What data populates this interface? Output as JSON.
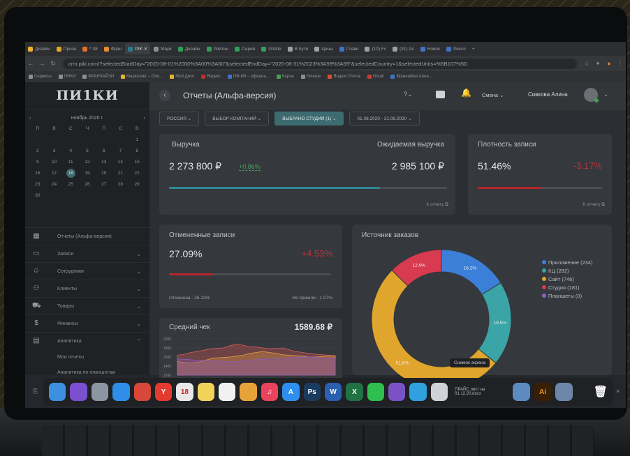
{
  "browser": {
    "tabs": [
      {
        "label": "Дизайн",
        "color": "#f2b02e",
        "active": false
      },
      {
        "label": "Презе",
        "color": "#e5a52a",
        "active": false
      },
      {
        "label": "* 38",
        "color": "#e56f2a",
        "active": false
      },
      {
        "label": "Фран",
        "color": "#e88d2b",
        "active": false
      },
      {
        "label": "PIK ✕",
        "color": "#2a7c89",
        "active": true
      },
      {
        "label": "Марк",
        "color": "#8b8f94",
        "active": false
      },
      {
        "label": "Дизайн",
        "color": "#2f9e57",
        "active": false
      },
      {
        "label": "Рейтин",
        "color": "#2f9e57",
        "active": false
      },
      {
        "label": "Серия",
        "color": "#2f9e57",
        "active": false
      },
      {
        "label": "Untitle",
        "color": "#2f9e57",
        "active": false
      },
      {
        "label": "В пути",
        "color": "#9aa0a6",
        "active": false
      },
      {
        "label": "Цены",
        "color": "#9aa0a6",
        "active": false
      },
      {
        "label": "Главн",
        "color": "#3e72c5",
        "active": false
      },
      {
        "label": "(10) Fc",
        "color": "#9aa0a6",
        "active": false
      },
      {
        "label": "(31) Ac",
        "color": "#9aa0a6",
        "active": false
      },
      {
        "label": "Новос",
        "color": "#3e72c5",
        "active": false
      },
      {
        "label": "Реклс",
        "color": "#3e72c5",
        "active": false
      }
    ],
    "new_tab": "+",
    "url": "crm.piki.com/?selectedStartDay=\"2020-08-01%2000%3A00%3A00\"&selectedEndDay=\"2020-08-31%2023%3A59%3A59\"&selectedCountry=1&selectedUnits=%5B107%5D",
    "bookmarks": [
      {
        "label": "Сервисы",
        "color": "#8a8f94"
      },
      {
        "label": "ПИКИ",
        "color": "#8a8f94"
      },
      {
        "label": "ФРАНЧАЙЗИ",
        "color": "#8a8f94"
      },
      {
        "label": "Маркетинг – Goo...",
        "color": "#e0b531"
      },
      {
        "label": "Мой Диск",
        "color": "#e0b531"
      },
      {
        "label": "Яндекс",
        "color": "#b7342c"
      },
      {
        "label": "ПИ-КИ – официа...",
        "color": "#3e72c5"
      },
      {
        "label": "Карты",
        "color": "#4a9e5b"
      },
      {
        "label": "Личное",
        "color": "#8a8f94"
      },
      {
        "label": "Яндекс Почта",
        "color": "#d7502c"
      },
      {
        "label": "Gmail",
        "color": "#c63c32"
      },
      {
        "label": "Франчайзи Алин...",
        "color": "#3e72c5"
      }
    ]
  },
  "sidebar": {
    "logo": "ПИ1КИ",
    "calendar": {
      "month": "ноябрь 2020 г.",
      "prev": "‹",
      "next": "›",
      "weekdays": [
        "П",
        "В",
        "С",
        "Ч",
        "П",
        "С",
        "В"
      ],
      "days": [
        "",
        "",
        "",
        "",
        "",
        "",
        "1",
        "2",
        "3",
        "4",
        "5",
        "6",
        "7",
        "8",
        "9",
        "10",
        "11",
        "12",
        "13",
        "14",
        "15",
        "16",
        "17",
        "18",
        "19",
        "20",
        "21",
        "22",
        "23",
        "24",
        "25",
        "26",
        "27",
        "28",
        "29",
        "30",
        "",
        "",
        "",
        "",
        "",
        ""
      ],
      "selected": "18"
    },
    "menu": [
      {
        "label": "Отчеты (Альфа-версия)",
        "icon": "▦",
        "chevron": ""
      },
      {
        "label": "Записи",
        "icon": "▭",
        "chevron": "⌄"
      },
      {
        "label": "Сотрудники",
        "icon": "☺",
        "chevron": "⌄"
      },
      {
        "label": "Клиенты",
        "icon": "⚇",
        "chevron": "⌄"
      },
      {
        "label": "Товары",
        "icon": "⛟",
        "chevron": "⌄"
      },
      {
        "label": "Финансы",
        "icon": "$",
        "chevron": "⌄"
      },
      {
        "label": "Аналитика",
        "icon": "▤",
        "chevron": "⌃"
      }
    ],
    "submenu": [
      "Мои отчеты",
      "Аналитика по планшетам"
    ]
  },
  "header": {
    "back": "‹",
    "title": "Отчеты (Альфа-версия)",
    "help": "?⌄",
    "shift": "Смена ⌄",
    "user": "Сивкова Алина",
    "user_chevron": "⌄"
  },
  "filters": [
    {
      "label": "РОССИЯ ⌄",
      "active": false
    },
    {
      "label": "ВЫБОР КОМПАНИЙ ⌄",
      "active": false
    },
    {
      "label": "ВЫБРАНО СТУДИЙ (1) ⌄",
      "active": true
    },
    {
      "label": "01.08.2020 - 31.08.2020 ⌄",
      "active": false
    }
  ],
  "revenue": {
    "title": "Выручка",
    "value": "2 273 800 ₽",
    "delta": "+0.86%",
    "expected_title": "Ожидаемая выручка",
    "expected_value": "2 985 100 ₽",
    "progress": 0.76,
    "link": "К отчету ⧉",
    "color": "#2f8a96"
  },
  "density": {
    "title": "Плотность записи",
    "value": "51.46%",
    "delta": "-3.17%",
    "progress": 0.51,
    "link": "К отчету ⧉",
    "color": "#b8262b"
  },
  "cancelled": {
    "title": "Отмененные записи",
    "value": "27.09%",
    "delta": "+4.53%",
    "progress": 0.27,
    "left_note": "Отменена - 25.13%",
    "right_note": "Не пришли - 1.97%",
    "color": "#b8262b"
  },
  "avg_check": {
    "title": "Средний чек",
    "value": "1589.68 ₽"
  },
  "chart_data": [
    {
      "type": "pie",
      "title": "Источник заказов",
      "slices": [
        {
          "name": "Приложение (234)",
          "value": 234,
          "label": "16.2%",
          "color": "#3b7fd8"
        },
        {
          "name": "КЦ (282)",
          "value": 282,
          "label": "19.5%",
          "color": "#3aa4a6"
        },
        {
          "name": "Сайт (746)",
          "value": 746,
          "label": "51.6%",
          "color": "#e0a52c"
        },
        {
          "name": "Студия (181)",
          "value": 181,
          "label": "12.5%",
          "color": "#d83a4f"
        },
        {
          "name": "Планшеты (0)",
          "value": 0,
          "label": "",
          "color": "#8b62c9"
        }
      ],
      "tooltip": "Снимок экрана"
    },
    {
      "type": "area",
      "title": "Средний чек",
      "y_ticks": [
        "2000",
        "1800",
        "1600",
        "1400",
        "1200"
      ],
      "ylim": [
        1200,
        2000
      ],
      "series": [
        {
          "color": "#d95a5a",
          "values": [
            1640,
            1660,
            1700,
            1720,
            1750,
            1780,
            1790,
            1800,
            1850,
            1880,
            1860,
            1830,
            1820,
            1800,
            1780,
            1790,
            1800,
            1760,
            1720,
            1700,
            1680,
            1660,
            1650,
            1640,
            1630
          ]
        },
        {
          "color": "#e39a43",
          "values": [
            1500,
            1480,
            1470,
            1480,
            1520,
            1560,
            1580,
            1590,
            1600,
            1620,
            1640,
            1680,
            1700,
            1720,
            1700,
            1680,
            1650,
            1640,
            1630,
            1620,
            1600,
            1600,
            1610,
            1620,
            1620
          ]
        },
        {
          "color": "#8a5ac2",
          "values": [
            1560,
            1550,
            1540,
            1530,
            1520,
            1520,
            1510,
            1500,
            1490,
            1500,
            1510,
            1530,
            1540,
            1550,
            1560,
            1560,
            1570,
            1580,
            1590,
            1600,
            1600,
            1590,
            1580,
            1570,
            1560
          ]
        }
      ]
    }
  ],
  "dock": {
    "apps": [
      {
        "name": "finder-icon",
        "label": "",
        "color": "#3d8fe0"
      },
      {
        "name": "siri-icon",
        "label": "",
        "color": "#7a4fd0"
      },
      {
        "name": "launchpad-icon",
        "label": "",
        "color": "#8c96a3"
      },
      {
        "name": "safari-icon",
        "label": "",
        "color": "#2f8fe8"
      },
      {
        "name": "chrome-icon",
        "label": "",
        "color": "#d9463a"
      },
      {
        "name": "yandex-browser-icon",
        "label": "Y",
        "color": "#e33b2e"
      },
      {
        "name": "calendar-icon",
        "label": "18",
        "color": "#e8e8e8"
      },
      {
        "name": "notes-icon",
        "label": "",
        "color": "#f2d35a"
      },
      {
        "name": "reminders-icon",
        "label": "",
        "color": "#f1f1f1"
      },
      {
        "name": "photos-icon",
        "label": "",
        "color": "#e8a23a"
      },
      {
        "name": "music-icon",
        "label": "♫",
        "color": "#e9435d"
      },
      {
        "name": "app-store-icon",
        "label": "A",
        "color": "#2e8ff0"
      },
      {
        "name": "photoshop-icon",
        "label": "Ps",
        "color": "#1b3b5e"
      },
      {
        "name": "word-icon",
        "label": "W",
        "color": "#2b5fb0"
      },
      {
        "name": "excel-icon",
        "label": "X",
        "color": "#207245"
      },
      {
        "name": "whatsapp-icon",
        "label": "",
        "color": "#2fbf4f"
      },
      {
        "name": "viber-icon",
        "label": "",
        "color": "#7b52c6"
      },
      {
        "name": "telegram-icon",
        "label": "",
        "color": "#2ea1de"
      },
      {
        "name": "preview-icon",
        "label": "",
        "color": "#cfd3d7"
      }
    ],
    "file_label": "ПРАЙС лист на 01.12.20.docx",
    "right_apps": [
      {
        "name": "image-file-icon",
        "label": "",
        "color": "#5d8bc0"
      },
      {
        "name": "illustrator-icon",
        "label": "Ai",
        "color": "#3a1f07"
      },
      {
        "name": "screenshot-file-icon",
        "label": "",
        "color": "#6e87a8"
      }
    ],
    "trash": "🗑",
    "right_glyph": "×",
    "left_glyph": "⎘"
  }
}
